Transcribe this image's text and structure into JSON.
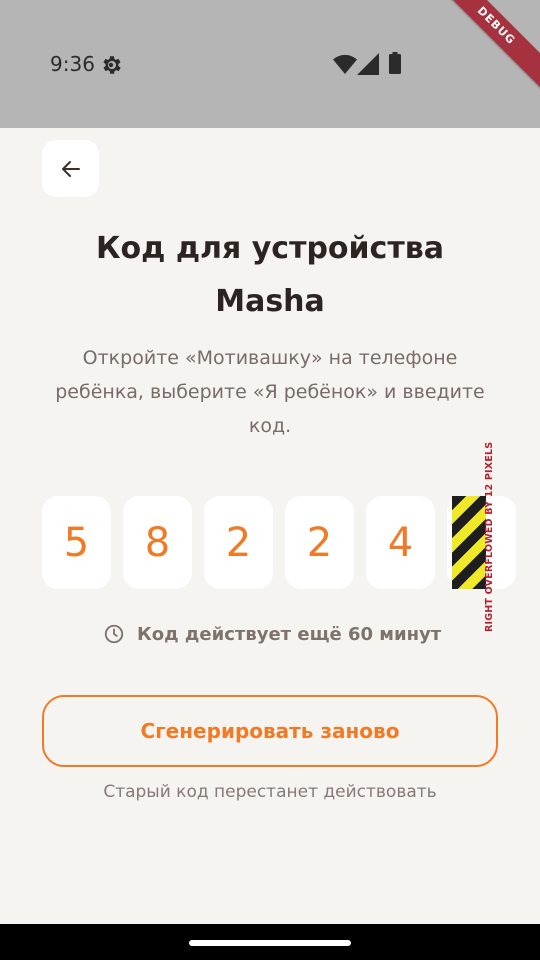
{
  "status_bar": {
    "time": "9:36",
    "debug_label": "DEBUG"
  },
  "header": {
    "back_icon": "arrow-left-icon"
  },
  "title": "Код для устройства Masha",
  "subtitle": "Откройте «Мотивашку» на телефоне ребёнка, выберите «Я ребёнок» и введите код.",
  "code": {
    "digits": [
      "5",
      "8",
      "2",
      "2",
      "4"
    ],
    "overflow_warning": "RIGHT OVERFLOWED BY 12 PIXELS"
  },
  "timer": {
    "icon": "clock-icon",
    "text": "Код действует ещё 60 минут"
  },
  "regenerate": {
    "label": "Сгенерировать заново",
    "hint": "Старый код перестанет действовать"
  },
  "colors": {
    "accent": "#f07a26",
    "background": "#f6f4f1",
    "title": "#2c2420",
    "muted": "#776c66"
  }
}
